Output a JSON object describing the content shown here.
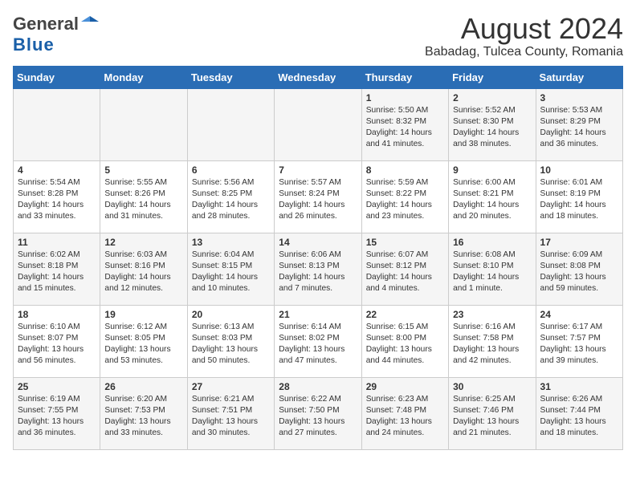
{
  "header": {
    "logo_general": "General",
    "logo_blue": "Blue",
    "month_year": "August 2024",
    "location": "Babadag, Tulcea County, Romania"
  },
  "weekdays": [
    "Sunday",
    "Monday",
    "Tuesday",
    "Wednesday",
    "Thursday",
    "Friday",
    "Saturday"
  ],
  "weeks": [
    [
      {
        "day": "",
        "content": ""
      },
      {
        "day": "",
        "content": ""
      },
      {
        "day": "",
        "content": ""
      },
      {
        "day": "",
        "content": ""
      },
      {
        "day": "1",
        "content": "Sunrise: 5:50 AM\nSunset: 8:32 PM\nDaylight: 14 hours\nand 41 minutes."
      },
      {
        "day": "2",
        "content": "Sunrise: 5:52 AM\nSunset: 8:30 PM\nDaylight: 14 hours\nand 38 minutes."
      },
      {
        "day": "3",
        "content": "Sunrise: 5:53 AM\nSunset: 8:29 PM\nDaylight: 14 hours\nand 36 minutes."
      }
    ],
    [
      {
        "day": "4",
        "content": "Sunrise: 5:54 AM\nSunset: 8:28 PM\nDaylight: 14 hours\nand 33 minutes."
      },
      {
        "day": "5",
        "content": "Sunrise: 5:55 AM\nSunset: 8:26 PM\nDaylight: 14 hours\nand 31 minutes."
      },
      {
        "day": "6",
        "content": "Sunrise: 5:56 AM\nSunset: 8:25 PM\nDaylight: 14 hours\nand 28 minutes."
      },
      {
        "day": "7",
        "content": "Sunrise: 5:57 AM\nSunset: 8:24 PM\nDaylight: 14 hours\nand 26 minutes."
      },
      {
        "day": "8",
        "content": "Sunrise: 5:59 AM\nSunset: 8:22 PM\nDaylight: 14 hours\nand 23 minutes."
      },
      {
        "day": "9",
        "content": "Sunrise: 6:00 AM\nSunset: 8:21 PM\nDaylight: 14 hours\nand 20 minutes."
      },
      {
        "day": "10",
        "content": "Sunrise: 6:01 AM\nSunset: 8:19 PM\nDaylight: 14 hours\nand 18 minutes."
      }
    ],
    [
      {
        "day": "11",
        "content": "Sunrise: 6:02 AM\nSunset: 8:18 PM\nDaylight: 14 hours\nand 15 minutes."
      },
      {
        "day": "12",
        "content": "Sunrise: 6:03 AM\nSunset: 8:16 PM\nDaylight: 14 hours\nand 12 minutes."
      },
      {
        "day": "13",
        "content": "Sunrise: 6:04 AM\nSunset: 8:15 PM\nDaylight: 14 hours\nand 10 minutes."
      },
      {
        "day": "14",
        "content": "Sunrise: 6:06 AM\nSunset: 8:13 PM\nDaylight: 14 hours\nand 7 minutes."
      },
      {
        "day": "15",
        "content": "Sunrise: 6:07 AM\nSunset: 8:12 PM\nDaylight: 14 hours\nand 4 minutes."
      },
      {
        "day": "16",
        "content": "Sunrise: 6:08 AM\nSunset: 8:10 PM\nDaylight: 14 hours\nand 1 minute."
      },
      {
        "day": "17",
        "content": "Sunrise: 6:09 AM\nSunset: 8:08 PM\nDaylight: 13 hours\nand 59 minutes."
      }
    ],
    [
      {
        "day": "18",
        "content": "Sunrise: 6:10 AM\nSunset: 8:07 PM\nDaylight: 13 hours\nand 56 minutes."
      },
      {
        "day": "19",
        "content": "Sunrise: 6:12 AM\nSunset: 8:05 PM\nDaylight: 13 hours\nand 53 minutes."
      },
      {
        "day": "20",
        "content": "Sunrise: 6:13 AM\nSunset: 8:03 PM\nDaylight: 13 hours\nand 50 minutes."
      },
      {
        "day": "21",
        "content": "Sunrise: 6:14 AM\nSunset: 8:02 PM\nDaylight: 13 hours\nand 47 minutes."
      },
      {
        "day": "22",
        "content": "Sunrise: 6:15 AM\nSunset: 8:00 PM\nDaylight: 13 hours\nand 44 minutes."
      },
      {
        "day": "23",
        "content": "Sunrise: 6:16 AM\nSunset: 7:58 PM\nDaylight: 13 hours\nand 42 minutes."
      },
      {
        "day": "24",
        "content": "Sunrise: 6:17 AM\nSunset: 7:57 PM\nDaylight: 13 hours\nand 39 minutes."
      }
    ],
    [
      {
        "day": "25",
        "content": "Sunrise: 6:19 AM\nSunset: 7:55 PM\nDaylight: 13 hours\nand 36 minutes."
      },
      {
        "day": "26",
        "content": "Sunrise: 6:20 AM\nSunset: 7:53 PM\nDaylight: 13 hours\nand 33 minutes."
      },
      {
        "day": "27",
        "content": "Sunrise: 6:21 AM\nSunset: 7:51 PM\nDaylight: 13 hours\nand 30 minutes."
      },
      {
        "day": "28",
        "content": "Sunrise: 6:22 AM\nSunset: 7:50 PM\nDaylight: 13 hours\nand 27 minutes."
      },
      {
        "day": "29",
        "content": "Sunrise: 6:23 AM\nSunset: 7:48 PM\nDaylight: 13 hours\nand 24 minutes."
      },
      {
        "day": "30",
        "content": "Sunrise: 6:25 AM\nSunset: 7:46 PM\nDaylight: 13 hours\nand 21 minutes."
      },
      {
        "day": "31",
        "content": "Sunrise: 6:26 AM\nSunset: 7:44 PM\nDaylight: 13 hours\nand 18 minutes."
      }
    ]
  ]
}
